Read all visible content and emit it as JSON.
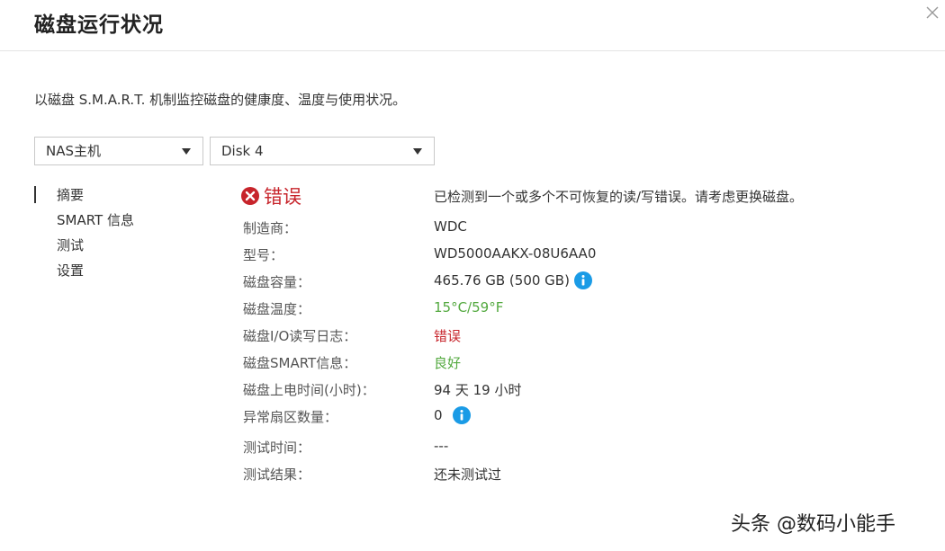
{
  "dialog": {
    "title": "磁盘运行状况",
    "description": "以磁盘 S.M.A.R.T. 机制监控磁盘的健康度、温度与使用状况。"
  },
  "selectors": {
    "host": "NAS主机",
    "disk": "Disk 4"
  },
  "nav": {
    "items": [
      {
        "label": "摘要",
        "active": true
      },
      {
        "label": "SMART 信息",
        "active": false
      },
      {
        "label": "测试",
        "active": false
      },
      {
        "label": "设置",
        "active": false
      }
    ]
  },
  "summary": {
    "status_label": "错误",
    "status_message": "已检测到一个或多个不可恢复的读/写错误。请考虑更换磁盘。",
    "rows": [
      {
        "label": "制造商：",
        "value": "WDC"
      },
      {
        "label": "型号：",
        "value": "WD5000AAKX-08U6AA0"
      },
      {
        "label": "磁盘容量：",
        "value": "465.76 GB (500 GB)"
      },
      {
        "label": "磁盘温度：",
        "value": "15°C/59°F"
      },
      {
        "label": "磁盘I/O读写日志：",
        "value": "错误"
      },
      {
        "label": "磁盘SMART信息：",
        "value": "良好"
      },
      {
        "label": "磁盘上电时间(小时)：",
        "value": "94 天 19 小时"
      },
      {
        "label": "异常扇区数量：",
        "value": "0"
      },
      {
        "label": "测试时间：",
        "value": "---"
      },
      {
        "label": "测试结果：",
        "value": "还未测试过"
      }
    ]
  },
  "colors": {
    "error": "#c7242b",
    "good": "#53a93f",
    "info": "#1a9be6"
  },
  "icons": {
    "close": "close-icon",
    "status": "error-circle-icon",
    "info": "info-icon"
  },
  "watermark": "头条 @数码小能手"
}
